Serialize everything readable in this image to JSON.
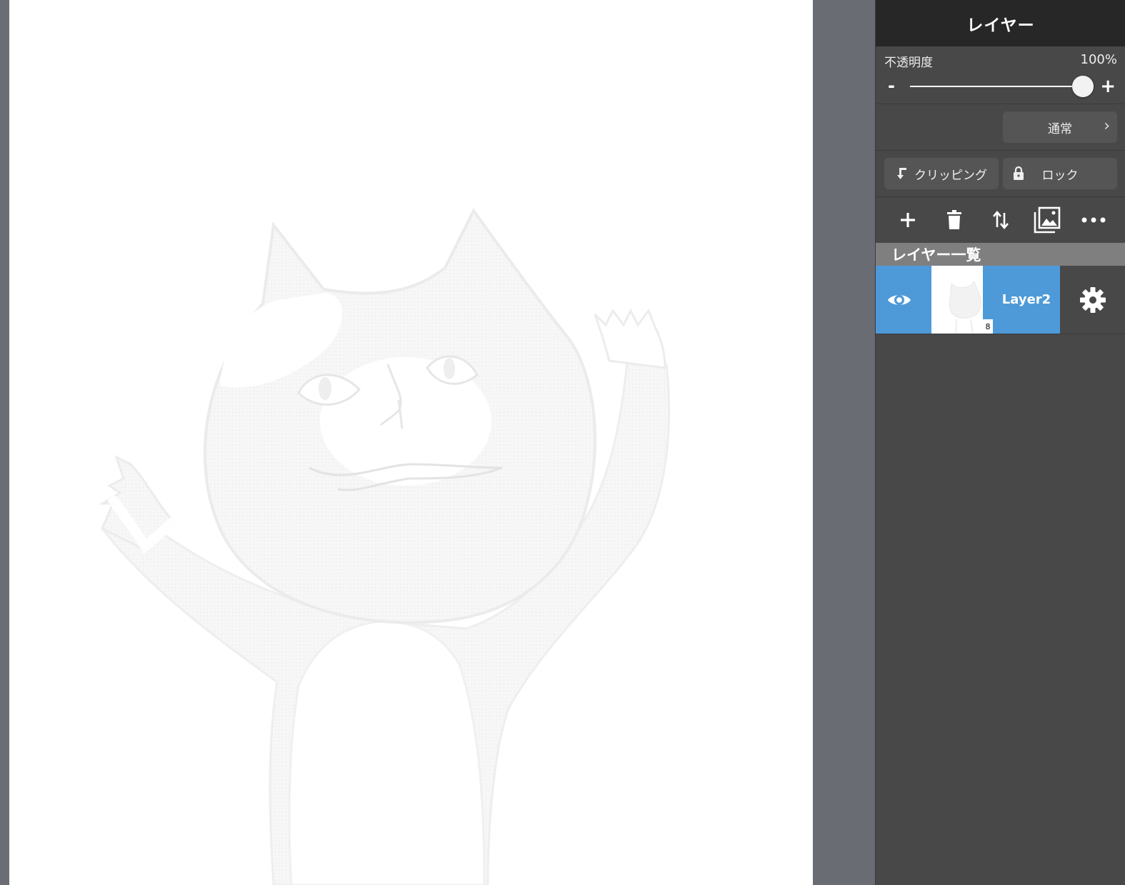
{
  "panel": {
    "title": "レイヤー",
    "opacity": {
      "label": "不透明度",
      "value_text": "100%",
      "value": 1.0,
      "minus": "-",
      "plus": "+"
    },
    "blend_mode": {
      "label": "通常",
      "chevron": "›"
    },
    "clipping": {
      "label": "クリッピング",
      "icon": "clipping-arrow-icon"
    },
    "lock": {
      "label": "ロック",
      "icon": "lock-icon"
    },
    "toolbar": [
      "add-icon",
      "trash-icon",
      "move-updown-icon",
      "image-icon",
      "more-icon"
    ],
    "list_header": "レイヤー一覧",
    "layers": [
      {
        "name": "Layer2",
        "visible": true,
        "selected": true,
        "thumb_badge": "8"
      }
    ]
  },
  "colors": {
    "selection": "#4e9ad8",
    "panel_bg": "#484848",
    "header_bg": "#272727",
    "gutter": "#696c72"
  }
}
